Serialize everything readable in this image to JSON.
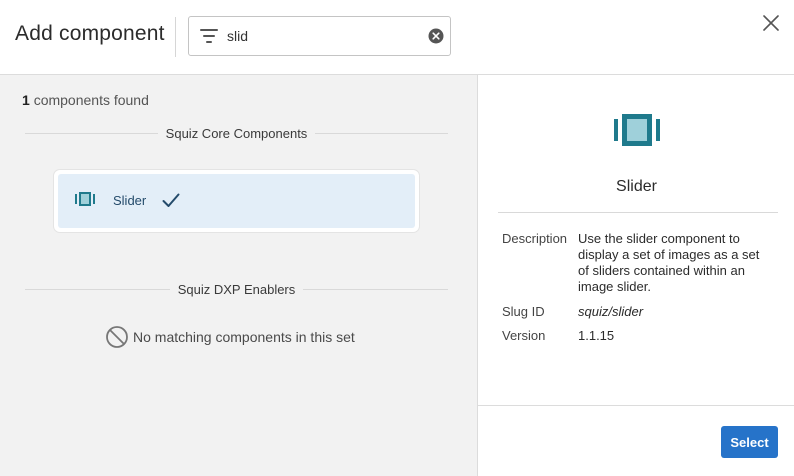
{
  "header": {
    "title": "Add component",
    "search": {
      "value": "slid",
      "placeholder": "Search components"
    }
  },
  "results": {
    "count": "1",
    "count_label": "components found",
    "sets": [
      {
        "name": "Squiz Core Components",
        "components": [
          {
            "name": "Slider",
            "selected": true
          }
        ]
      },
      {
        "name": "Squiz DXP Enablers",
        "empty_message": "No matching components in this set"
      }
    ]
  },
  "detail": {
    "title": "Slider",
    "fields": [
      {
        "key": "Description",
        "value": "Use the slider component to display a set of images as a set of sliders contained within an image slider."
      },
      {
        "key": "Slug ID",
        "value": "squiz/slider"
      },
      {
        "key": "Version",
        "value": "1.1.15"
      }
    ],
    "select_label": "Select"
  },
  "icons": {
    "filter": "filter-icon",
    "clear": "clear-circle-icon",
    "close": "close-icon",
    "component": "slider-icon",
    "check": "check-icon",
    "empty": "ban-icon"
  },
  "colors": {
    "accent": "#2673c9",
    "icon_teal": "#1f7a8c",
    "selected_bg": "#e3eef8",
    "panel_bg": "#f2f2f2"
  }
}
